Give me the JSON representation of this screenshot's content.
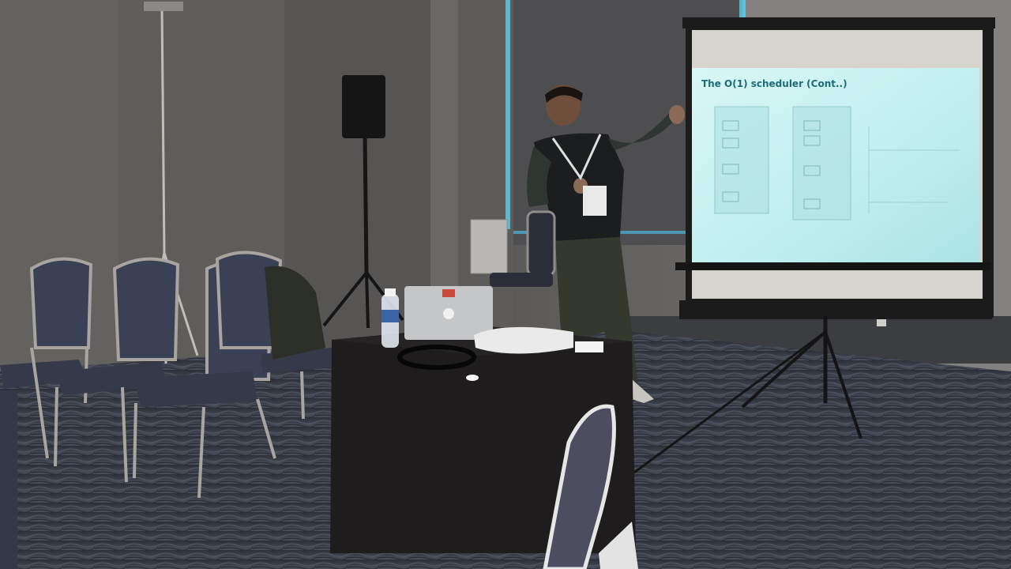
{
  "slide": {
    "title": "The O(1) scheduler (Cont..)"
  },
  "colors": {
    "wall": "#6e6c69",
    "carpet": "#272a33",
    "screen": "#c9ecec",
    "chair_seat": "#3b4155",
    "table_cloth": "#1e1c1d"
  }
}
